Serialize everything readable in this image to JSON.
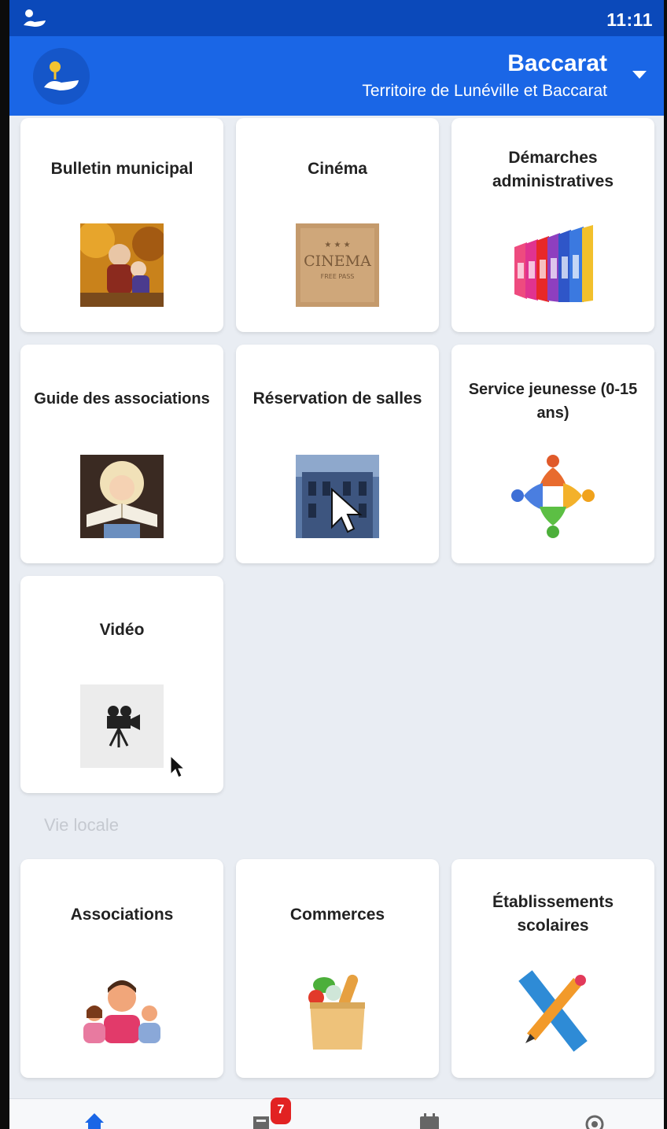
{
  "statusbar": {
    "time": "11:11"
  },
  "header": {
    "title": "Baccarat",
    "subtitle": "Territoire de Lunéville et Baccarat"
  },
  "tiles": [
    {
      "label": "Bulletin municipal",
      "icon": "autumn-photo"
    },
    {
      "label": "Cinéma",
      "icon": "cinema-ticket"
    },
    {
      "label": "Démarches administratives",
      "icon": "colored-binders"
    },
    {
      "label": "Guide des associations",
      "icon": "girl-with-book"
    },
    {
      "label": "Réservation de salles",
      "icon": "building-with-cursor"
    },
    {
      "label": "Service jeunesse (0-15 ans)",
      "icon": "people-circle"
    },
    {
      "label": "Vidéo",
      "icon": "video-camera"
    }
  ],
  "section": {
    "title": "Vie locale"
  },
  "local_tiles": [
    {
      "label": "Associations",
      "icon": "three-people"
    },
    {
      "label": "Commerces",
      "icon": "grocery-bag"
    },
    {
      "label": "Établissements scolaires",
      "icon": "ruler-pencil"
    }
  ],
  "bottom_nav": {
    "notification_count": "7",
    "items": [
      "home-icon",
      "news-icon",
      "calendar-icon",
      "settings-icon"
    ]
  },
  "colors": {
    "statusbar": "#0b49ba",
    "appbar": "#1a66e6",
    "background": "#e9edf3",
    "badge": "#e22222"
  }
}
